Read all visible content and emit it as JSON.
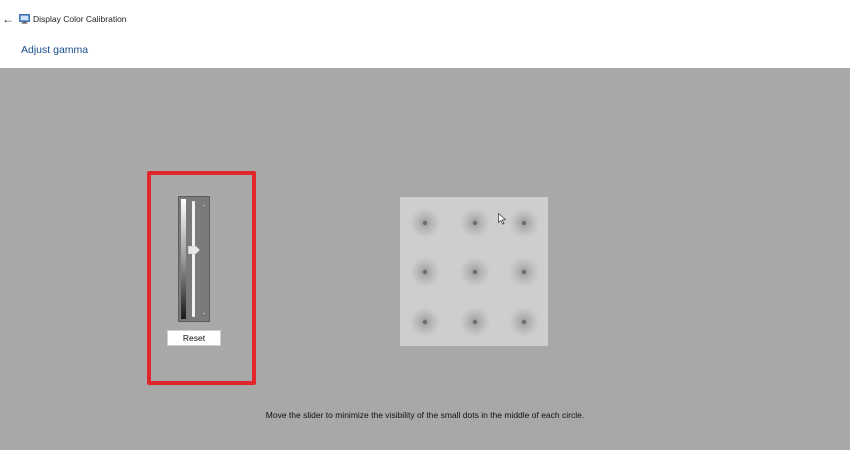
{
  "window": {
    "app_title": "Display Color Calibration",
    "back_icon": "back-arrow-icon",
    "app_icon": "display-calibration-icon"
  },
  "page": {
    "title": "Adjust gamma"
  },
  "gamma_control": {
    "level": 0.42,
    "orientation": "vertical",
    "reset_label": "Reset"
  },
  "sample": {
    "rows": 3,
    "columns": 3,
    "description": "gamma-reference-circles"
  },
  "instructions": {
    "text": "Move the slider to minimize the visibility of the small dots in the middle of each circle."
  },
  "colors": {
    "background": "#a8a8a8",
    "header_background": "#ffffff",
    "title_color": "#1a4c8c",
    "highlight_border": "#e0262b",
    "slider_panel": "#7a7a7a"
  }
}
